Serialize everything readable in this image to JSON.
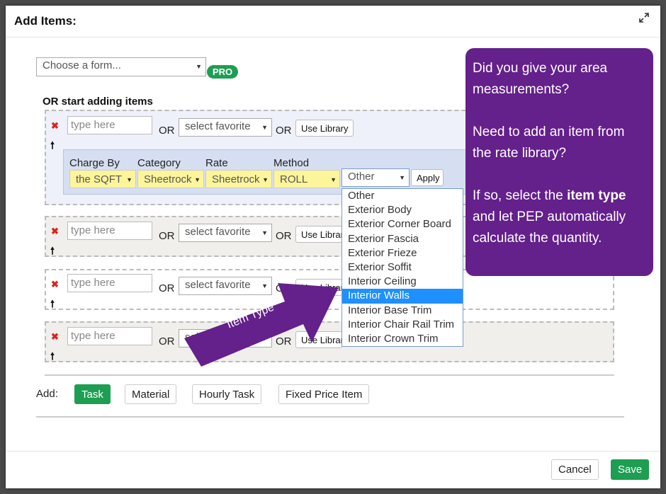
{
  "modal": {
    "title": "Add Items:"
  },
  "form_select": {
    "value": "Choose a form..."
  },
  "pro_badge": "PRO",
  "or_start": "OR start adding items",
  "rows": [
    {
      "input_placeholder": "type here",
      "or1": "OR",
      "favorite": "select favorite",
      "or2": "OR",
      "library": "Use Library"
    },
    {
      "input_placeholder": "type here",
      "or1": "OR",
      "favorite": "select favorite",
      "or2": "OR",
      "library": "Use Library"
    },
    {
      "input_placeholder": "type here",
      "or1": "OR",
      "favorite": "select favorite",
      "or2": "OR",
      "library": "Use Library"
    },
    {
      "input_placeholder": "type here",
      "or1": "OR",
      "favorite": "select favorite",
      "or2": "OR",
      "library": "Use Library"
    }
  ],
  "details": {
    "headers": [
      "Charge By",
      "Category",
      "Rate",
      "Method"
    ],
    "charge_by": "the SQFT",
    "category": "Sheetrock",
    "rate": "Sheetrock",
    "method": "ROLL",
    "item_type": "Other",
    "apply": "Apply"
  },
  "item_type_options": [
    "Other",
    "Exterior Body",
    "Exterior Corner Board",
    "Exterior Fascia",
    "Exterior Frieze",
    "Exterior Soffit",
    "Interior Ceiling",
    "Interior Walls",
    "Interior Base Trim",
    "Interior Chair Rail Trim",
    "Interior Crown Trim"
  ],
  "highlighted_option": "Interior Walls",
  "callout": {
    "p1": "Did you give your area measurements?",
    "p2": "Need to add an item from the rate library?",
    "p3_pre": "If so, select the ",
    "p3_bold": "item type",
    "p3_post": " and let PEP automatically calculate the quantity."
  },
  "arrow_label": "Item Type",
  "add_bar": {
    "label": "Add:",
    "task": "Task",
    "material": "Material",
    "hourly": "Hourly Task",
    "fixed": "Fixed Price Item"
  },
  "footer": {
    "cancel": "Cancel",
    "save": "Save"
  },
  "colors": {
    "green": "#1e9e52",
    "purple": "#64208b",
    "highlight": "#1e90ff",
    "yellow": "#fdf59a"
  },
  "icons": [
    "expand-icon",
    "remove-icon",
    "move-up-icon",
    "dropdown-arrow-icon"
  ]
}
